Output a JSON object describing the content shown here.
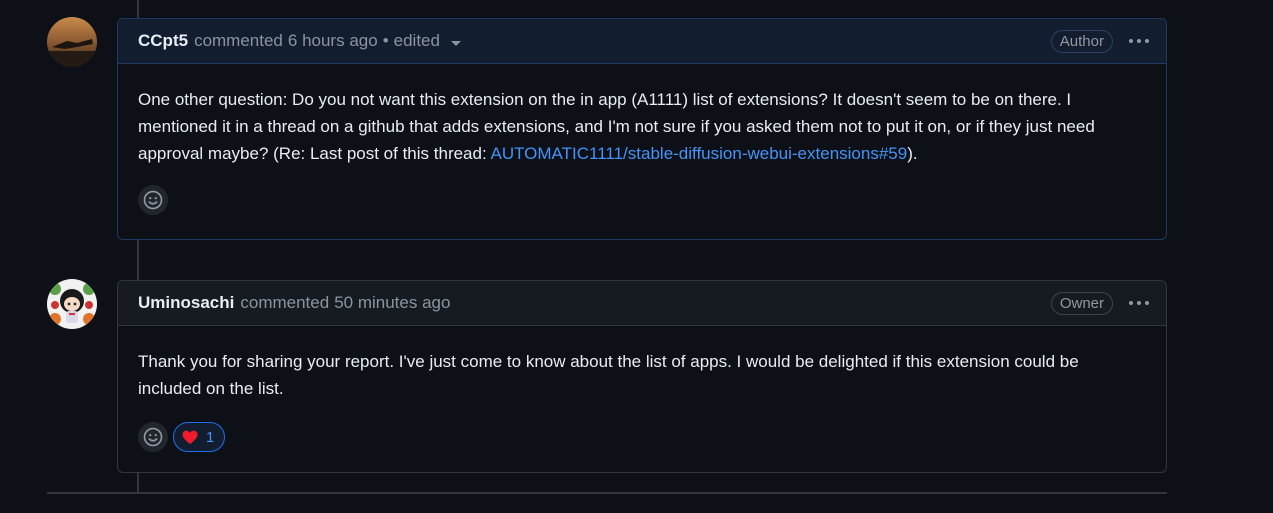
{
  "comments": [
    {
      "username": "CCpt5",
      "action": "commented",
      "time": "6 hours ago",
      "separator": "•",
      "edited": "edited",
      "role": "Author",
      "body_text": "One other question: Do you not want this extension on the in app (A1111) list of extensions? It doesn't seem to be on there. I mentioned it in a thread on a github that adds extensions, and I'm not sure if you asked them not to put it on, or if they just need approval maybe? (Re: Last post of this thread: ",
      "link_text": "AUTOMATIC1111/stable-diffusion-webui-extensions#59",
      "body_tail": ")."
    },
    {
      "username": "Uminosachi",
      "action": "commented",
      "time": "50 minutes ago",
      "role": "Owner",
      "body_text": "Thank you for sharing your report. I've just come to know about the list of apps. I would be delighted if this extension could be included on the list.",
      "reaction_emoji": "heart",
      "reaction_count": "1"
    }
  ],
  "colors": {
    "background": "#0d1117",
    "border": "#30363d",
    "link": "#4493f8",
    "muted": "#8b949e",
    "heart": "#f85149"
  },
  "icons": {
    "smiley": "smiley-icon",
    "kebab": "kebab-horizontal-icon",
    "heart": "heart-icon",
    "caret": "triangle-down-icon"
  }
}
